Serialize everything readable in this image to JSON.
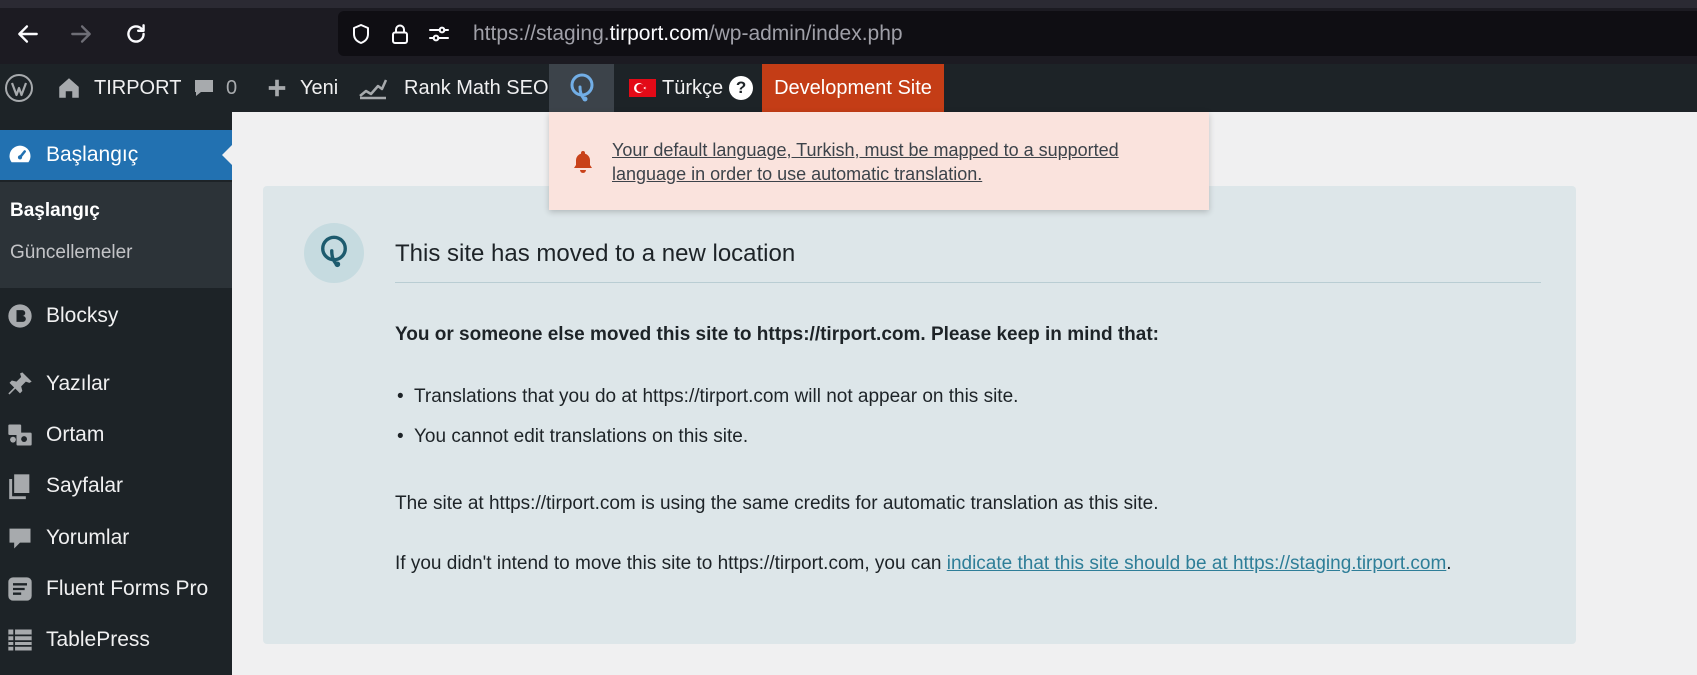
{
  "browser": {
    "url_prefix": "https://staging.",
    "url_domain": "tirport.com",
    "url_path": "/wp-admin/index.php",
    "icons": [
      "back-icon",
      "forward-icon",
      "reload-icon",
      "shield-icon",
      "lock-icon",
      "permissions-icon"
    ]
  },
  "adminbar": {
    "site_name": "TIRPORT",
    "comments_count": "0",
    "new_label": "Yeni",
    "seo_label": "Rank Math SEO",
    "language_label": "Türkçe",
    "help_label": "?",
    "dev_label": "Development Site",
    "dev_color": "#c43d16"
  },
  "sidebar": {
    "active_label": "Başlangıç",
    "submenu": [
      "Başlangıç",
      "Güncellemeler"
    ],
    "items": [
      "Blocksy",
      "Yazılar",
      "Ortam",
      "Sayfalar",
      "Yorumlar",
      "Fluent Forms Pro",
      "TablePress"
    ],
    "accent_color": "#2271b1"
  },
  "notice": {
    "text": "Your default language, Turkish, must be mapped to a supported language in order to use automatic translation.",
    "icon": "bell-icon",
    "color": "#c9421a"
  },
  "panel": {
    "title": "This site has moved to a new location",
    "intro": "You or someone else moved this site to https://tirport.com. Please keep in mind that:",
    "bullets": [
      "Translations that you do at https://tirport.com will not appear on this site.",
      "You cannot edit translations on this site."
    ],
    "credits": "The site at https://tirport.com is using the same credits for automatic translation as this site.",
    "intent_prefix": "If you didn't intend to move this site to https://tirport.com, you can ",
    "intent_link": "indicate that this site should be at https://staging.tirport.com",
    "intent_suffix": "."
  }
}
